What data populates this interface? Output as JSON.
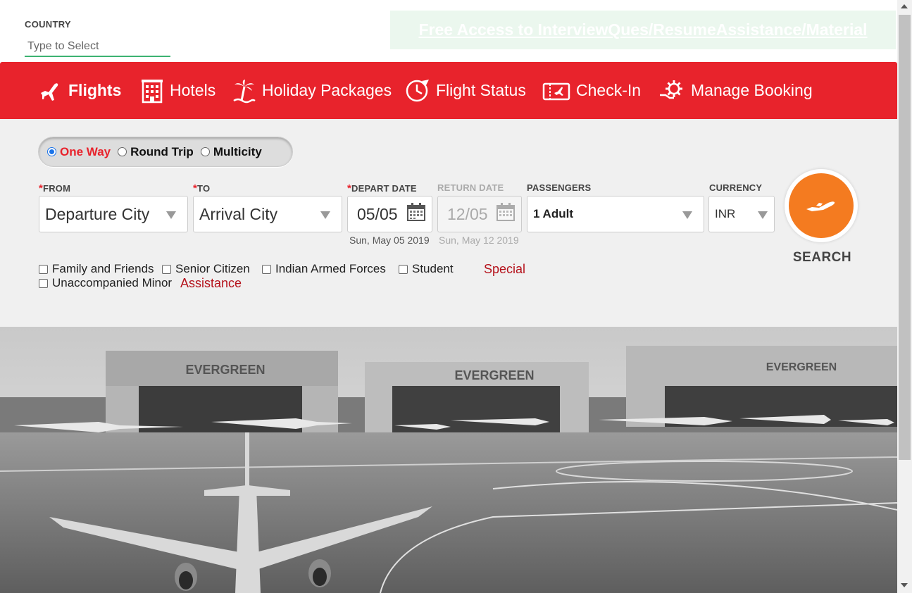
{
  "country": {
    "label": "COUNTRY",
    "placeholder": "Type to Select"
  },
  "promo": {
    "text": "Free Access to InterviewQues/ResumeAssistance/Material",
    "bg_color": "#ebf7ee"
  },
  "nav": {
    "bg_color": "#e8232c",
    "items": [
      {
        "label": "Flights",
        "icon": "airplane-icon",
        "active": true
      },
      {
        "label": "Hotels",
        "icon": "hotel-building-icon"
      },
      {
        "label": "Holiday Packages",
        "icon": "palm-tree-icon"
      },
      {
        "label": "Flight Status",
        "icon": "clock-plane-icon"
      },
      {
        "label": "Check-In",
        "icon": "ticket-icon"
      },
      {
        "label": "Manage Booking",
        "icon": "gear-hand-icon"
      }
    ]
  },
  "trip_type": {
    "options": [
      {
        "label": "One Way",
        "selected": true
      },
      {
        "label": "Round Trip",
        "selected": false
      },
      {
        "label": "Multicity",
        "selected": false
      }
    ]
  },
  "form": {
    "from": {
      "required_mark": "*",
      "label": "FROM",
      "value": "Departure City"
    },
    "to": {
      "required_mark": "*",
      "label": "TO",
      "value": "Arrival City"
    },
    "depart": {
      "required_mark": "*",
      "label": "DEPART DATE",
      "value": "05/05",
      "full_date": "Sun, May 05 2019"
    },
    "return": {
      "label": "RETURN DATE",
      "value": "12/05",
      "full_date": "Sun, May 12 2019",
      "disabled": true
    },
    "passengers": {
      "label": "PASSENGERS",
      "value": "1 Adult"
    },
    "currency": {
      "label": "CURRENCY",
      "value": "INR"
    }
  },
  "search": {
    "label": "SEARCH",
    "color": "#f47b20"
  },
  "discounts": {
    "options": [
      "Family and Friends",
      "Senior Citizen",
      "Indian Armed Forces",
      "Student",
      "Unaccompanied Minor"
    ],
    "special_line1": "Special",
    "special_line2": "Assistance"
  },
  "hero": {
    "hangar_sign": "EVERGREEN"
  }
}
